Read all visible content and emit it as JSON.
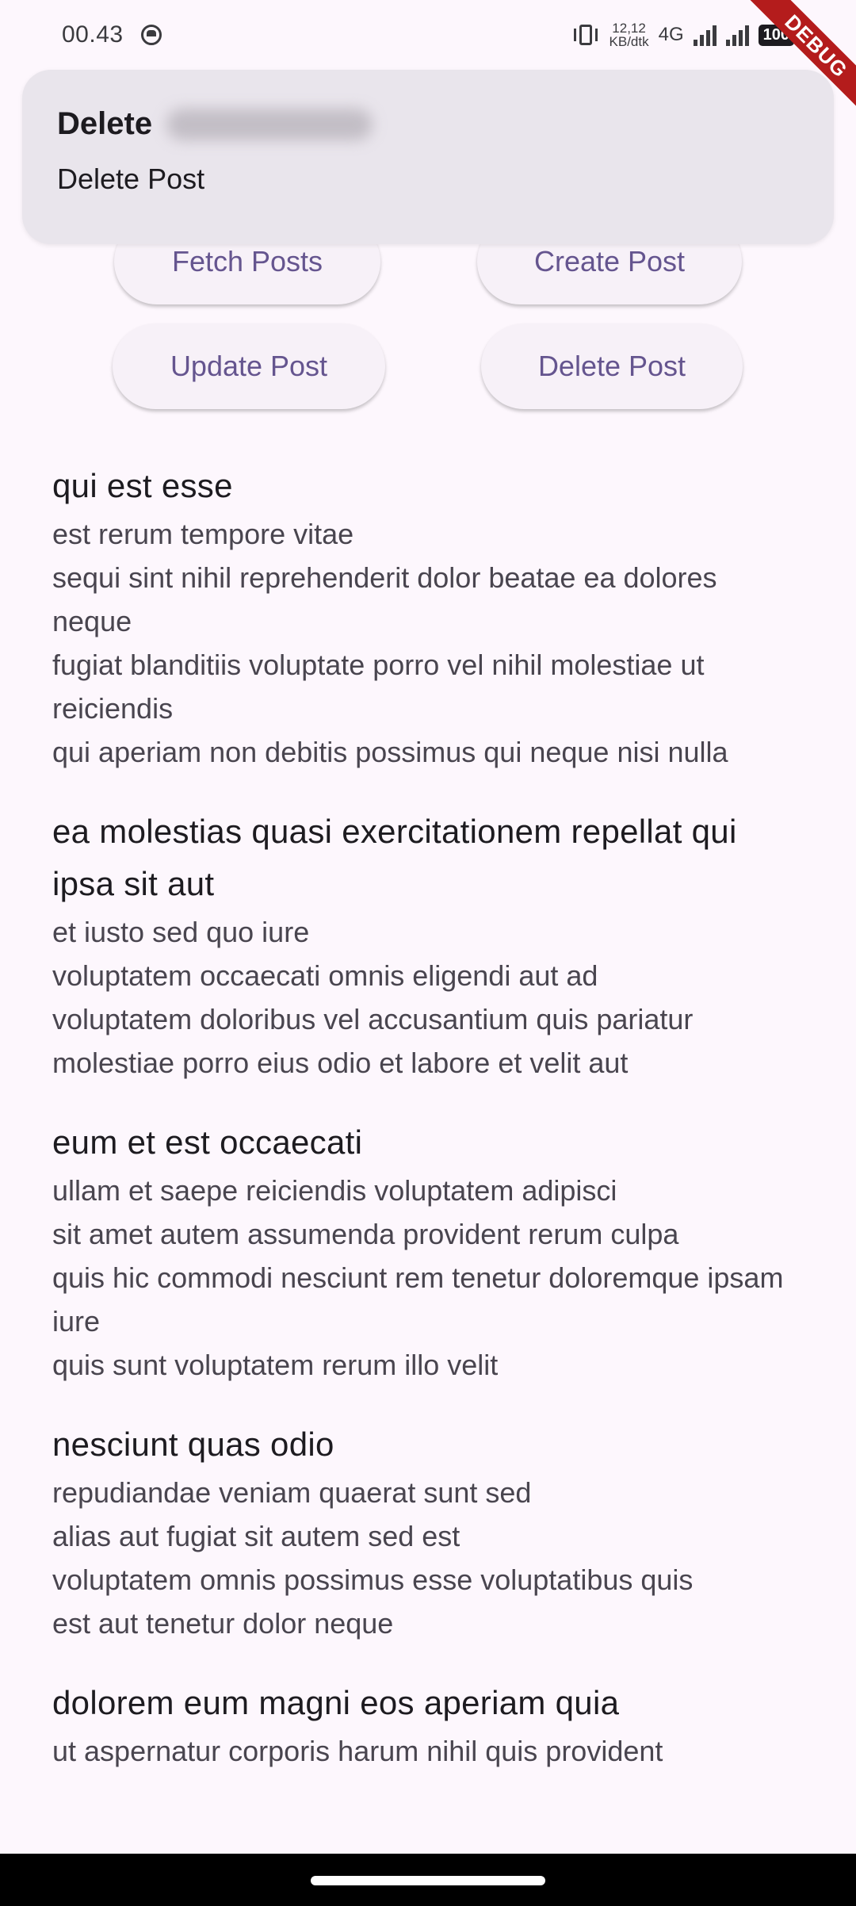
{
  "status_bar": {
    "time": "00.43",
    "net_speed_value": "12,12",
    "net_speed_unit": "KB/dtk",
    "network_type": "4G",
    "battery": "100"
  },
  "debug_banner": "DEBUG",
  "notification": {
    "title": "Delete",
    "body": "Delete Post"
  },
  "buttons": {
    "fetch": "Fetch Posts",
    "create": "Create Post",
    "update": "Update Post",
    "delete": "Delete Post"
  },
  "posts": [
    {
      "title": "qui est esse",
      "body": "est rerum tempore vitae\nsequi sint nihil reprehenderit dolor beatae ea dolores neque\nfugiat blanditiis voluptate porro vel nihil molestiae ut reiciendis\nqui aperiam non debitis possimus qui neque nisi nulla"
    },
    {
      "title": "ea molestias quasi exercitationem repellat qui ipsa sit aut",
      "body": "et iusto sed quo iure\nvoluptatem occaecati omnis eligendi aut ad\nvoluptatem doloribus vel accusantium quis pariatur\nmolestiae porro eius odio et labore et velit aut"
    },
    {
      "title": "eum et est occaecati",
      "body": "ullam et saepe reiciendis voluptatem adipisci\nsit amet autem assumenda provident rerum culpa\nquis hic commodi nesciunt rem tenetur doloremque ipsam iure\nquis sunt voluptatem rerum illo velit"
    },
    {
      "title": "nesciunt quas odio",
      "body": "repudiandae veniam quaerat sunt sed\nalias aut fugiat sit autem sed est\nvoluptatem omnis possimus esse voluptatibus quis\nest aut tenetur dolor neque"
    },
    {
      "title": "dolorem eum magni eos aperiam quia",
      "body": "ut aspernatur corporis harum nihil quis provident"
    }
  ],
  "colors": {
    "background": "#fdf7fd",
    "button_text": "#65558f",
    "notification_bg": "#e9e5ec",
    "debug_banner": "#b41c1c"
  }
}
